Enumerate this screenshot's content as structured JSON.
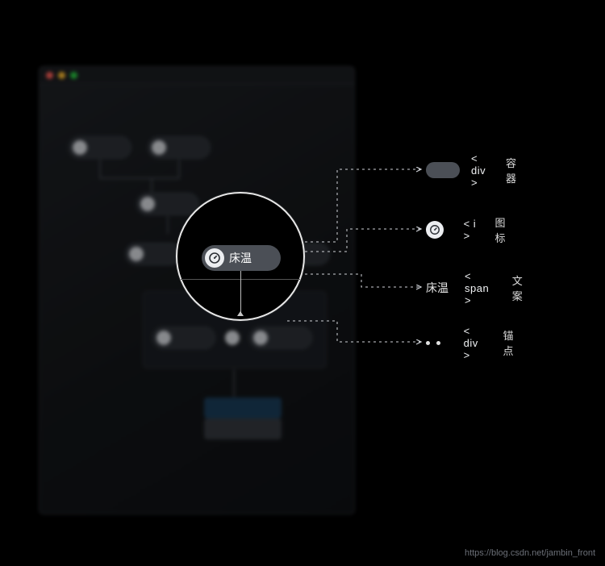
{
  "spotlight": {
    "node_label": "床温",
    "icon_name": "gauge-icon"
  },
  "legend": {
    "rows": [
      {
        "tag": "< div >",
        "desc": "容器",
        "sample_text": ""
      },
      {
        "tag": "< i >",
        "desc": "图标",
        "sample_text": ""
      },
      {
        "tag": "< span >",
        "desc": "文案",
        "sample_text": "床温"
      },
      {
        "tag": "< div >",
        "desc": "锚点",
        "sample_text": ""
      }
    ]
  },
  "source": "https://blog.csdn.net/jambin_front"
}
